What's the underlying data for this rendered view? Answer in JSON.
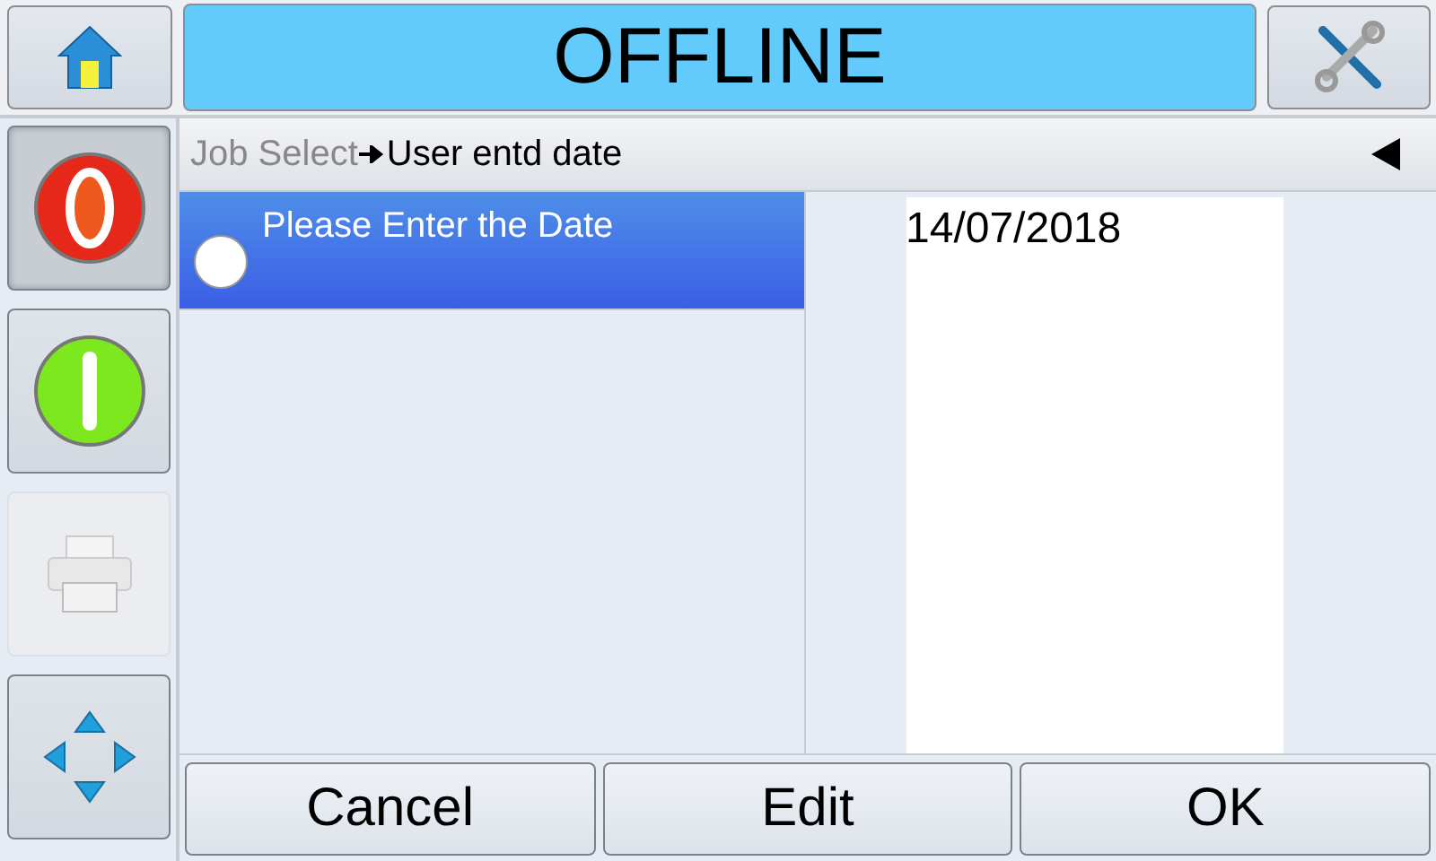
{
  "status": {
    "title": "OFFLINE"
  },
  "side_buttons": [
    {
      "kind": "stop",
      "disabled": false,
      "selected": true
    },
    {
      "kind": "start",
      "disabled": false,
      "selected": false
    },
    {
      "kind": "print",
      "disabled": true,
      "selected": false
    },
    {
      "kind": "navigate",
      "disabled": false,
      "selected": false
    }
  ],
  "breadcrumb": {
    "parent": "Job Select",
    "current": "User entd date"
  },
  "items": [
    {
      "label": "Please Enter the Date",
      "selected": true,
      "checked": false
    }
  ],
  "date_value": "14/07/2018",
  "buttons": [
    "Cancel",
    "Edit",
    "OK"
  ]
}
